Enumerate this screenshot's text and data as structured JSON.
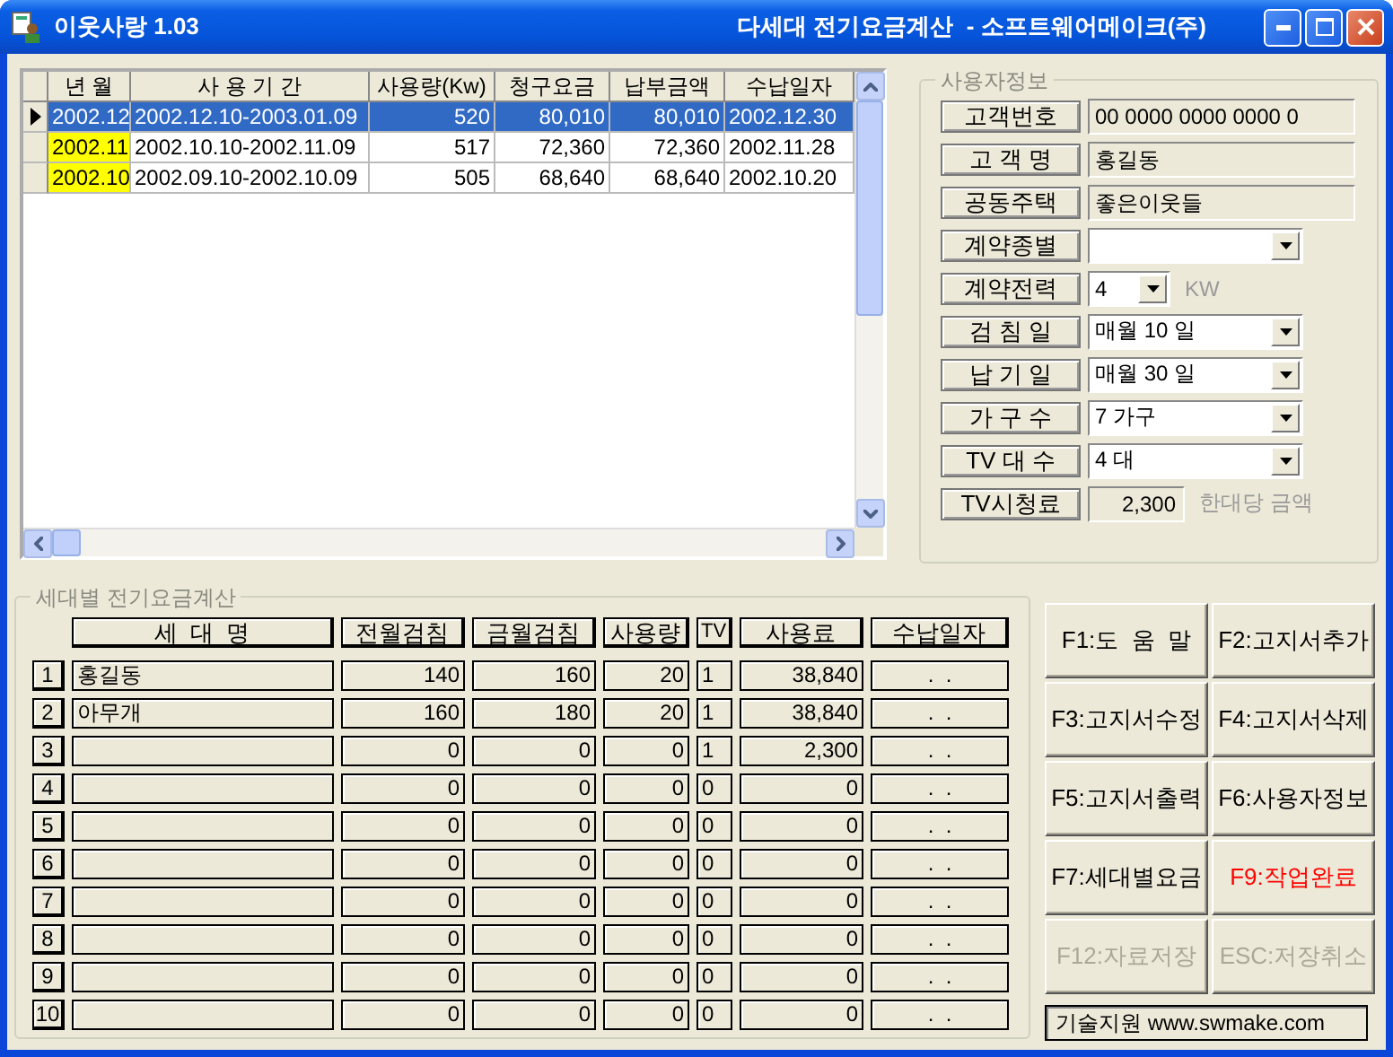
{
  "window": {
    "title": "이웃사랑 1.03",
    "subtitle": "다세대 전기요금계산  - 소프트웨어메이크(주)"
  },
  "bills": {
    "columns": [
      "년 월",
      "사  용  기  간",
      "사용량(Kw)",
      "청구요금",
      "납부금액",
      "수납일자"
    ],
    "rows": [
      {
        "selected": true,
        "marked": false,
        "cells": [
          "2002.12",
          "2002.12.10-2003.01.09",
          "520",
          "80,010",
          "80,010",
          "2002.12.30"
        ]
      },
      {
        "selected": false,
        "marked": true,
        "cells": [
          "2002.11",
          "2002.10.10-2002.11.09",
          "517",
          "72,360",
          "72,360",
          "2002.11.28"
        ]
      },
      {
        "selected": false,
        "marked": true,
        "cells": [
          "2002.10",
          "2002.09.10-2002.10.09",
          "505",
          "68,640",
          "68,640",
          "2002.10.20"
        ]
      }
    ]
  },
  "user_info": {
    "title": "사용자정보",
    "fields": [
      {
        "label": "고객번호",
        "kind": "text",
        "value": "00 0000 0000 0000 0"
      },
      {
        "label": "고 객 명",
        "kind": "text",
        "value": "홍길동"
      },
      {
        "label": "공동주택",
        "kind": "text",
        "value": "좋은이웃들"
      },
      {
        "label": "계약종별",
        "kind": "combo"
      },
      {
        "label": "계약전력",
        "kind": "small_combo",
        "value": "4",
        "unit": "KW"
      },
      {
        "label": "검 침 일",
        "kind": "combo",
        "value": "매월 10 일"
      },
      {
        "label": "납 기 일",
        "kind": "combo",
        "value": "매월 30 일"
      },
      {
        "label": "가 구 수",
        "kind": "combo",
        "value": "7 가구"
      },
      {
        "label": "TV 대 수",
        "kind": "combo",
        "value": "4 대"
      },
      {
        "label": "TV시청료",
        "kind": "readout",
        "value": "2,300",
        "unit": "한대당 금액"
      }
    ]
  },
  "households": {
    "title": "세대별 전기요금계산",
    "columns": [
      "세  대  명",
      "전월검침",
      "금월검침",
      "사용량",
      "TV",
      "사용료",
      "수납일자"
    ],
    "rows": [
      {
        "number": "1",
        "cells": [
          "홍길동",
          "140",
          "160",
          "20",
          "1",
          "38,840",
          ".  ."
        ]
      },
      {
        "number": "2",
        "cells": [
          "아무개",
          "160",
          "180",
          "20",
          "1",
          "38,840",
          ".  ."
        ]
      },
      {
        "number": "3",
        "cells": [
          "",
          "0",
          "0",
          "0",
          "1",
          "2,300",
          ".  ."
        ]
      },
      {
        "number": "4",
        "cells": [
          "",
          "0",
          "0",
          "0",
          "0",
          "0",
          ".  ."
        ]
      },
      {
        "number": "5",
        "cells": [
          "",
          "0",
          "0",
          "0",
          "0",
          "0",
          ".  ."
        ]
      },
      {
        "number": "6",
        "cells": [
          "",
          "0",
          "0",
          "0",
          "0",
          "0",
          ".  ."
        ]
      },
      {
        "number": "7",
        "cells": [
          "",
          "0",
          "0",
          "0",
          "0",
          "0",
          ".  ."
        ]
      },
      {
        "number": "8",
        "cells": [
          "",
          "0",
          "0",
          "0",
          "0",
          "0",
          ".  ."
        ]
      },
      {
        "number": "9",
        "cells": [
          "",
          "0",
          "0",
          "0",
          "0",
          "0",
          ".  ."
        ]
      },
      {
        "number": "10",
        "cells": [
          "",
          "0",
          "0",
          "0",
          "0",
          "0",
          ".  ."
        ]
      }
    ]
  },
  "buttons": [
    {
      "label": "F1:도  움  말",
      "kind": "normal",
      "disabled": false
    },
    {
      "label": "F2:고지서추가",
      "kind": "normal",
      "disabled": false
    },
    {
      "label": "F3:고지서수정",
      "kind": "normal",
      "disabled": false
    },
    {
      "label": "F4:고지서삭제",
      "kind": "normal",
      "disabled": false
    },
    {
      "label": "F5:고지서출력",
      "kind": "normal",
      "disabled": false
    },
    {
      "label": "F6:사용자정보",
      "kind": "normal",
      "disabled": false
    },
    {
      "label": "F7:세대별요금",
      "kind": "normal",
      "disabled": false
    },
    {
      "label": "F9:작업완료",
      "kind": "accent",
      "disabled": false
    },
    {
      "label": "F12:자료저장",
      "kind": "normal",
      "disabled": true
    },
    {
      "label": "ESC:저장취소",
      "kind": "normal",
      "disabled": true
    }
  ],
  "support": "기술지원 www.swmake.com"
}
